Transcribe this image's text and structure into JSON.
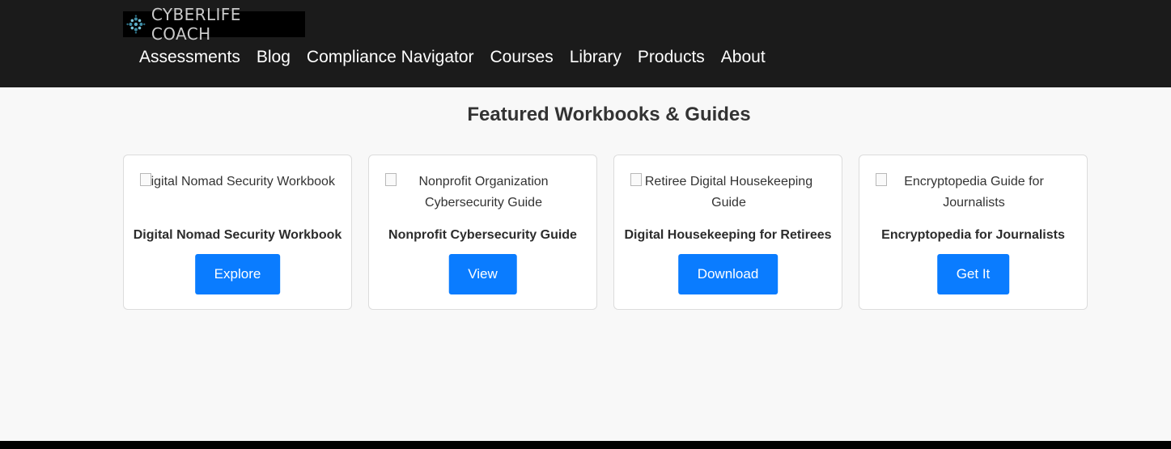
{
  "header": {
    "logo_text": "CYBERLIFE COACH",
    "nav": [
      "Assessments",
      "Blog",
      "Compliance Navigator",
      "Courses",
      "Library",
      "Products",
      "About"
    ]
  },
  "section": {
    "title": "Featured Workbooks & Guides",
    "cards": [
      {
        "image_alt": "Digital Nomad Security Workbook",
        "title": "Digital Nomad Security Workbook",
        "button": "Explore"
      },
      {
        "image_alt": "Nonprofit Organization Cybersecurity Guide",
        "title": "Nonprofit Cybersecurity Guide",
        "button": "View"
      },
      {
        "image_alt": "Retiree Digital Housekeeping Guide",
        "title": "Digital Housekeeping for Retirees",
        "button": "Download"
      },
      {
        "image_alt": "Encryptopedia Guide for Journalists",
        "title": "Encryptopedia for Journalists",
        "button": "Get It"
      }
    ]
  },
  "colors": {
    "header_bg": "#1b1b1b",
    "button_bg": "#0a7cff",
    "page_bg": "#f8f8f8"
  }
}
